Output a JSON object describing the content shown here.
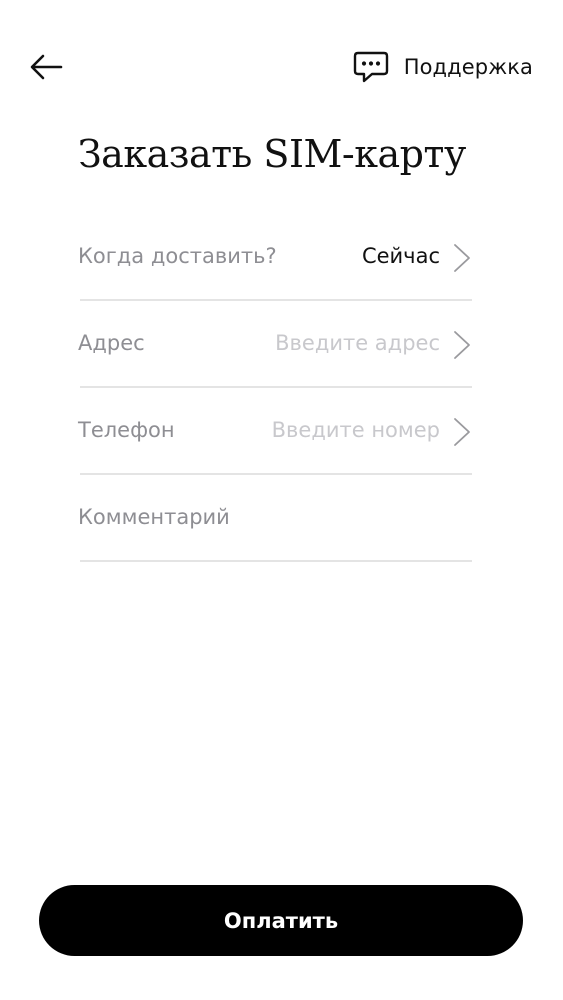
{
  "header": {
    "back_icon": "arrow-left-icon",
    "support_icon": "chat-bubble-icon",
    "support_label": "Поддержка"
  },
  "page": {
    "title": "Заказать SIM-карту"
  },
  "form": {
    "delivery": {
      "label": "Когда доставить?",
      "value": "Сейчас"
    },
    "address": {
      "label": "Адрес",
      "placeholder": "Введите адрес"
    },
    "phone": {
      "label": "Телефон",
      "placeholder": "Введите номер"
    },
    "comment": {
      "label": "Комментарий"
    }
  },
  "actions": {
    "pay_label": "Оплатить"
  },
  "colors": {
    "button_background": "#000000",
    "button_text": "#ffffff",
    "label_text": "#8e8e93",
    "placeholder_text": "#c8c8cc",
    "divider": "#e4e4e4"
  }
}
